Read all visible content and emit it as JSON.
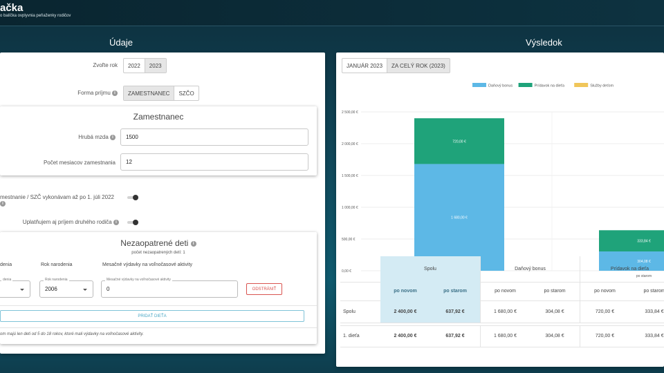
{
  "header": {
    "title": "ačka",
    "subtitle": "o balíčka ovplyvnia peňaženky rodičov"
  },
  "left": {
    "section_title": "Údaje",
    "year_label": "Zvoľte rok",
    "year_options": [
      "2022",
      "2023"
    ],
    "income_label": "Forma príjmu",
    "income_options": [
      "ZAMESTNANEC",
      "SZČO"
    ],
    "employee_card": {
      "title": "Zamestnanec",
      "gross_label": "Hrubá mzda",
      "gross_value": "1500",
      "months_label": "Počet mesiacov zamestnania",
      "months_value": "12"
    },
    "toggle1_label": "mestnanie / SZČ vykonávam až po 1. júli 2022",
    "toggle2_label": "Uplatňujem aj príjem druhého rodiča",
    "children_card": {
      "title": "Nezaopatrené deti",
      "subtitle": "počet nezaopatrených detí: 1",
      "col1": "denia",
      "col2": "Rok narodenia",
      "col3": "Mesačné výdavky na voľnočasové aktivity",
      "field1_legend": "denia",
      "field2_legend": "Rok narodenia",
      "field2_value": "2006",
      "field3_legend": "Mesačné výdavky na voľnočasové aktivity",
      "field3_value": "0",
      "remove_label": "ODSTRÁNIŤ",
      "add_label": "PRIDAŤ DIEŤA",
      "note": "om majú len deti od 5 do 18 rokov, ktoré mali výdavky na voľnočasové aktivity."
    }
  },
  "right": {
    "section_title": "Výsledok",
    "tabs": [
      "JANUÁR 2023",
      "ZA CELÝ ROK (2023)"
    ],
    "active_tab": "ZA CELÝ ROK (2023)",
    "table": {
      "group_headers": [
        "Spolu",
        "Daňový bonus",
        "Prídavok na dieťa"
      ],
      "sub_headers": [
        "po novom",
        "po starom",
        "po novom",
        "po starom",
        "po novom",
        "po starom"
      ],
      "rows": [
        {
          "label": "Spolu",
          "values": [
            "2 400,00 €",
            "637,92 €",
            "1 680,00 €",
            "304,08 €",
            "720,00 €",
            "333,84 €"
          ]
        },
        {
          "label": "1. dieťa",
          "values": [
            "2 400,00 €",
            "637,92 €",
            "1 680,00 €",
            "304,08 €",
            "720,00 €",
            "333,84 €"
          ]
        }
      ]
    }
  },
  "chart_data": {
    "type": "bar",
    "stacked": true,
    "categories": [
      "po novom",
      "po starom"
    ],
    "series": [
      {
        "name": "Daňový bonus",
        "color": "#5db8e6",
        "values": [
          1680.0,
          304.08
        ],
        "labels": [
          "1 680,00 €",
          "304,08 €"
        ]
      },
      {
        "name": "Prídavok na dieťa",
        "color": "#1fa37a",
        "values": [
          720.0,
          333.84
        ],
        "labels": [
          "720,00 €",
          "333,84 €"
        ]
      },
      {
        "name": "Služby deťom",
        "color": "#f0c65a",
        "values": [
          0,
          0
        ],
        "labels": [
          "",
          ""
        ]
      }
    ],
    "yticks": [
      "0,00 €",
      "500,00 €",
      "1 000,00 €",
      "1 500,00 €",
      "2 000,00 €",
      "2 500,00 €"
    ],
    "ylim": [
      0,
      2500
    ],
    "grid": true,
    "legend": "top"
  }
}
